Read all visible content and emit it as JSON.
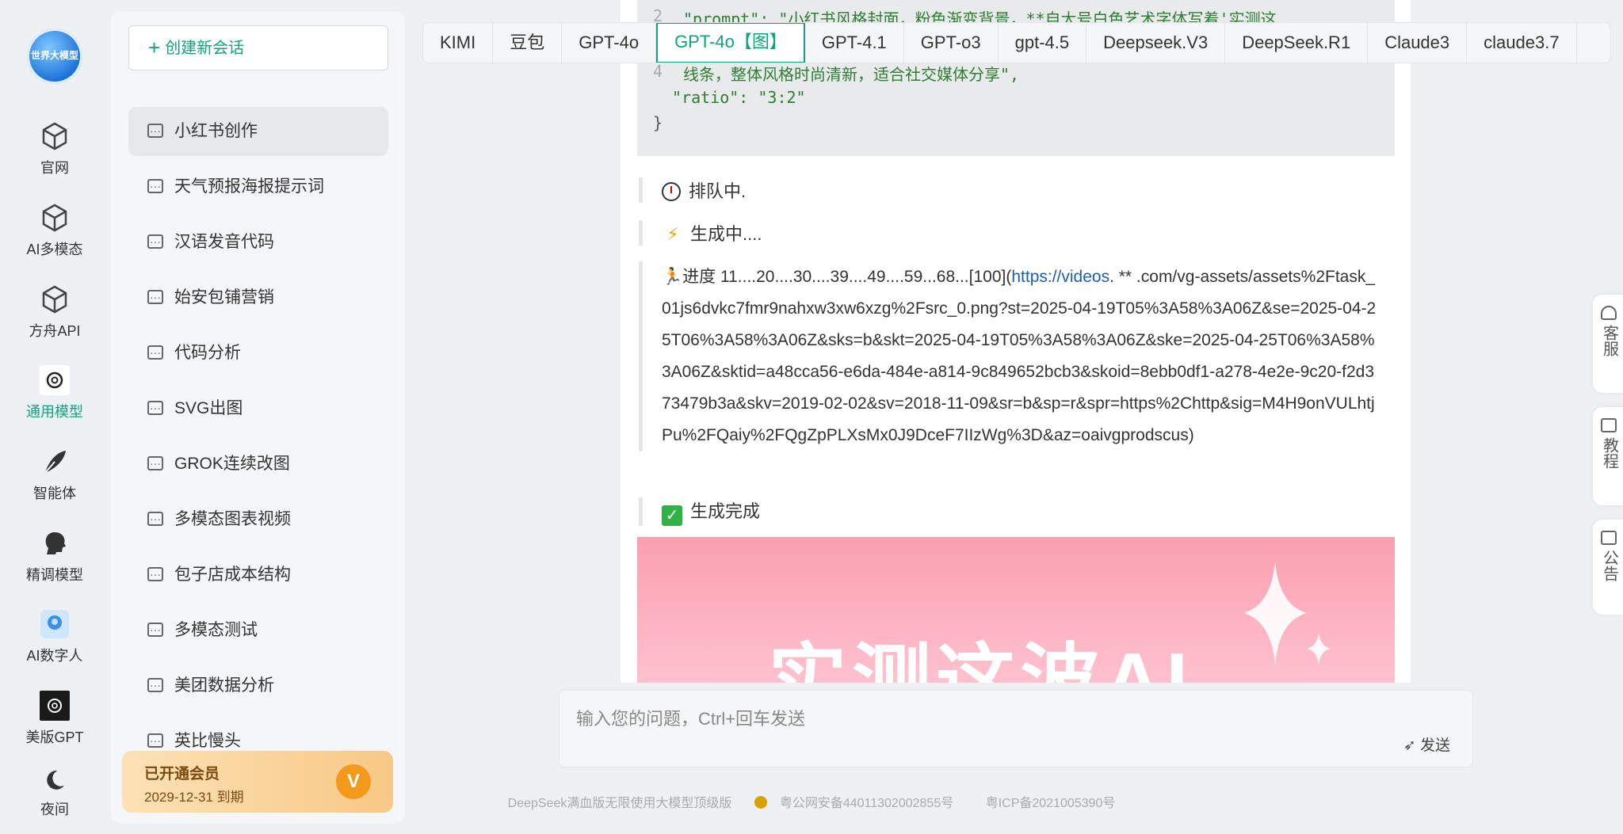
{
  "logo": {
    "text": "世界大模型"
  },
  "rail": [
    {
      "label": "官网",
      "icon": "cube-icon"
    },
    {
      "label": "AI多模态",
      "icon": "cube-icon"
    },
    {
      "label": "方舟API",
      "icon": "cube-icon"
    },
    {
      "label": "通用模型",
      "icon": "openai-icon"
    },
    {
      "label": "智能体",
      "icon": "feather-icon"
    },
    {
      "label": "精调模型",
      "icon": "head-icon"
    },
    {
      "label": "AI数字人",
      "icon": "digital-human-icon"
    },
    {
      "label": "美版GPT",
      "icon": "openai-dark-icon"
    },
    {
      "label": "夜间",
      "icon": "moon-icon"
    }
  ],
  "sidebar": {
    "new_chat": "创建新会话",
    "sessions": [
      "小红书创作",
      "天气预报海报提示词",
      "汉语发音代码",
      "始安包铺营销",
      "代码分析",
      "SVG出图",
      "GROK连续改图",
      "多模态图表视频",
      "包子店成本结构",
      "多模态测试",
      "美团数据分析",
      "英比慢头"
    ],
    "member_title": "已开通会员",
    "member_expiry": "2029-12-31 到期",
    "member_badge": "V"
  },
  "tabs": [
    "KIMI",
    "豆包",
    "GPT-4o",
    "GPT-4o【图】",
    "GPT-4.1",
    "GPT-o3",
    "gpt-4.5",
    "Deepseek.V3",
    "DeepSeek.R1",
    "Claude3",
    "claude3.7"
  ],
  "code": {
    "line2_no": "2",
    "line2": "\"prompt\": \"小红书风格封面，粉色渐变背景，**自大号白色艺术字体写着'实测这",
    "line4_no": "4",
    "line4": "线条，整体风格时尚清新，适合社交媒体分享\",",
    "line5": "\"ratio\": \"3:2\"",
    "close": "}"
  },
  "status": {
    "queue": "排队中.",
    "generating": "生成中....",
    "progress_prefix": "进度 11....20....30....39....49....59...68...[100](",
    "progress_link": "https://videos",
    "progress_rest": ". ** .com/vg-assets/assets%2Ftask_01js6dvkc7fmr9nahxw3xw6xzg%2Fsrc_0.png?st=2025-04-19T05%3A58%3A06Z&se=2025-04-25T06%3A58%3A06Z&sks=b&skt=2025-04-19T05%3A58%3A06Z&ske=2025-04-25T06%3A58%3A06Z&sktid=a48cca56-e6da-484e-a814-9c849652bcb3&skoid=8ebb0df1-a278-4e2e-9c20-f2d373479b3a&skv=2019-02-02&sv=2018-11-09&sr=b&sp=r&spr=https%2Chttp&sig=M4H9onVULhtjPu%2FQaiy%2FQgZpPLXsMx0J9DceF7IIzWg%3D&az=oaivgprodscus)",
    "done": "生成完成"
  },
  "poster": {
    "text": "实测这波AI"
  },
  "input": {
    "placeholder": "输入您的问题，Ctrl+回车发送",
    "send": "发送"
  },
  "footer": {
    "slogan": "DeepSeek满血版无限使用大模型顶级版",
    "police": "粤公网安备44011302002855号",
    "icp": "粤ICP备2021005390号"
  },
  "floats": [
    {
      "label": "客服"
    },
    {
      "label": "教程"
    },
    {
      "label": "公告"
    }
  ],
  "colors": {
    "accent": "#10a37f",
    "link": "#1a5fb4",
    "member_gradient_start": "#fde2b6",
    "member_gradient_end": "#f8c886"
  }
}
